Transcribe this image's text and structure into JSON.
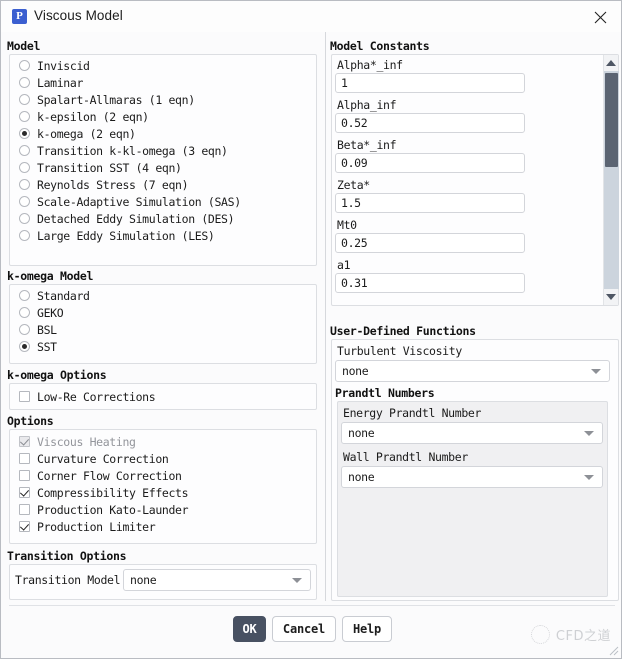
{
  "window": {
    "title": "Viscous Model",
    "icon_label": "P",
    "close_icon": "close-icon"
  },
  "model_group": {
    "title": "Model",
    "selected": "k-omega (2 eqn)",
    "items": [
      {
        "label": "Inviscid",
        "checked": false
      },
      {
        "label": "Laminar",
        "checked": false
      },
      {
        "label": "Spalart-Allmaras (1 eqn)",
        "checked": false
      },
      {
        "label": "k-epsilon (2 eqn)",
        "checked": false
      },
      {
        "label": "k-omega (2 eqn)",
        "checked": true
      },
      {
        "label": "Transition k-kl-omega (3 eqn)",
        "checked": false
      },
      {
        "label": "Transition SST (4 eqn)",
        "checked": false
      },
      {
        "label": "Reynolds Stress (7 eqn)",
        "checked": false
      },
      {
        "label": "Scale-Adaptive Simulation (SAS)",
        "checked": false
      },
      {
        "label": "Detached Eddy Simulation (DES)",
        "checked": false
      },
      {
        "label": "Large Eddy Simulation (LES)",
        "checked": false
      }
    ]
  },
  "komega_model_group": {
    "title": "k-omega Model",
    "selected": "SST",
    "items": [
      {
        "label": "Standard",
        "checked": false
      },
      {
        "label": "GEKO",
        "checked": false
      },
      {
        "label": "BSL",
        "checked": false
      },
      {
        "label": "SST",
        "checked": true
      }
    ]
  },
  "komega_options_group": {
    "title": "k-omega Options",
    "items": [
      {
        "label": "Low-Re Corrections",
        "checked": false,
        "disabled": false
      }
    ]
  },
  "options_group": {
    "title": "Options",
    "items": [
      {
        "label": "Viscous Heating",
        "checked": true,
        "disabled": true
      },
      {
        "label": "Curvature Correction",
        "checked": false,
        "disabled": false
      },
      {
        "label": "Corner Flow Correction",
        "checked": false,
        "disabled": false
      },
      {
        "label": "Compressibility Effects",
        "checked": true,
        "disabled": false
      },
      {
        "label": "Production Kato-Launder",
        "checked": false,
        "disabled": false
      },
      {
        "label": "Production Limiter",
        "checked": true,
        "disabled": false
      }
    ]
  },
  "transition_options_group": {
    "title": "Transition Options",
    "transition_model_label": "Transition Model",
    "transition_model_value": "none"
  },
  "model_constants_group": {
    "title": "Model Constants",
    "fields": [
      {
        "label": "Alpha*_inf",
        "value": "1"
      },
      {
        "label": "Alpha_inf",
        "value": "0.52"
      },
      {
        "label": "Beta*_inf",
        "value": "0.09"
      },
      {
        "label": "Zeta*",
        "value": "1.5"
      },
      {
        "label": "Mt0",
        "value": "0.25"
      },
      {
        "label": "a1",
        "value": "0.31"
      }
    ],
    "scroll": {
      "up_icon": "scroll-up-arrow-icon",
      "down_icon": "scroll-down-arrow-icon"
    }
  },
  "udf_group": {
    "title": "User-Defined Functions",
    "turbulent_viscosity_label": "Turbulent Viscosity",
    "turbulent_viscosity_value": "none",
    "prandtl": {
      "title": "Prandtl Numbers",
      "energy_label": "Energy Prandtl Number",
      "energy_value": "none",
      "wall_label": "Wall Prandtl Number",
      "wall_value": "none"
    }
  },
  "buttons": {
    "ok": "OK",
    "cancel": "Cancel",
    "help": "Help"
  },
  "watermark": {
    "text": "CFD之道"
  },
  "colors": {
    "accent": "#3b5fd0",
    "primary_button": "#485162",
    "panel_bg": "#fbfbfc",
    "group_bg": "#fdfdfe",
    "shaded_bg": "#f0f0f2",
    "scroll_thumb": "#5b6472",
    "border": "#dcdee2"
  }
}
